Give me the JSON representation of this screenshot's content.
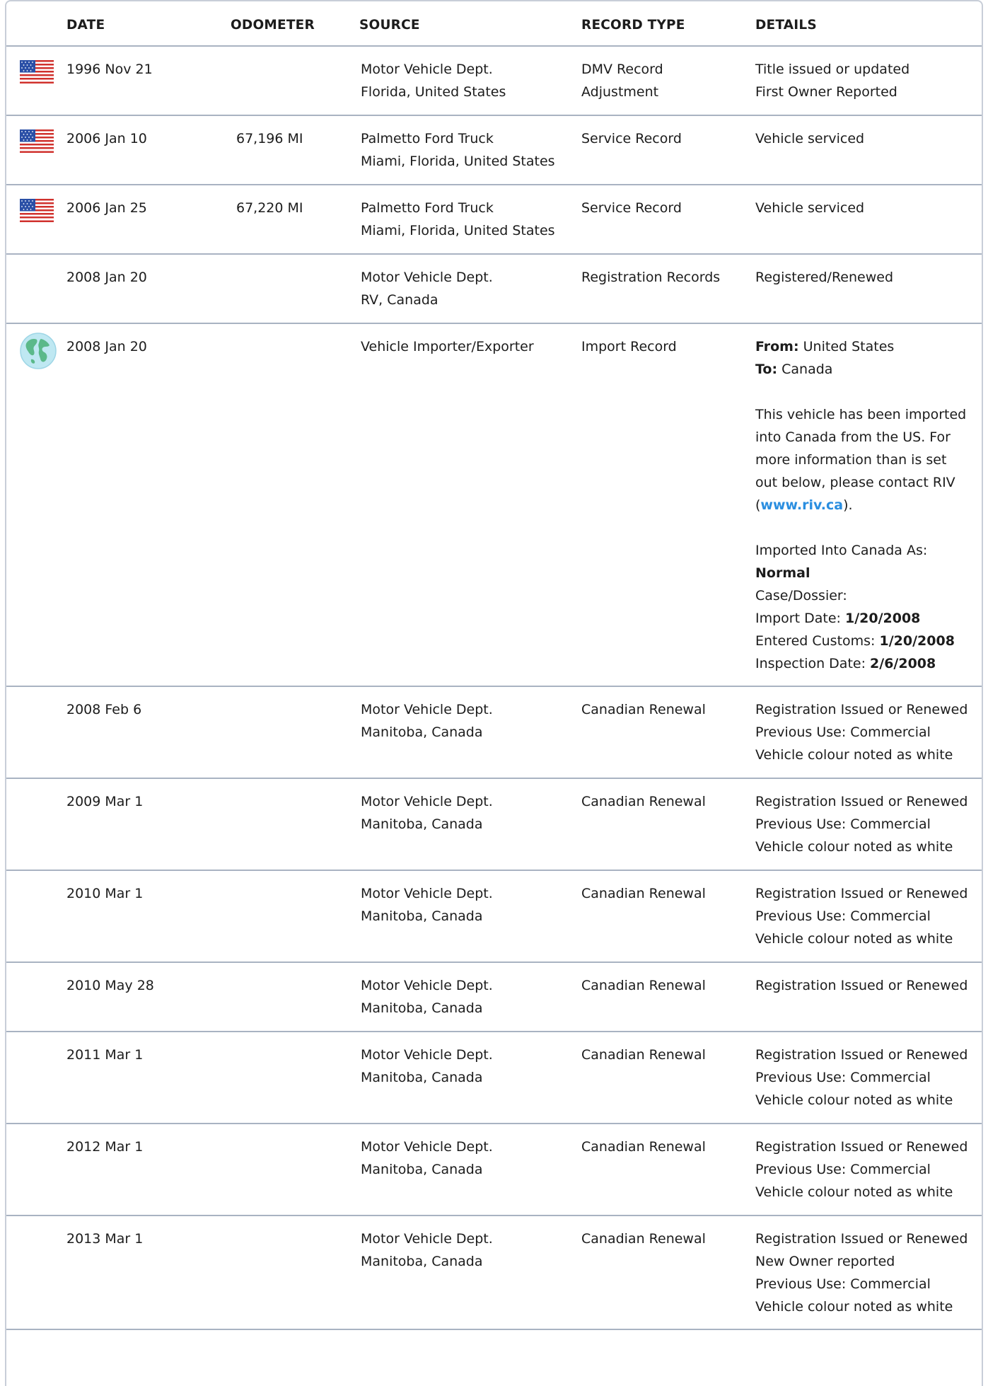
{
  "headers": {
    "date": "DATE",
    "odometer": "ODOMETER",
    "source": "SOURCE",
    "record_type": "RECORD TYPE",
    "details": "DETAILS"
  },
  "records": [
    {
      "icon": "us-flag-icon",
      "date": "1996 Nov 21",
      "odometer": "",
      "source": [
        "Motor Vehicle Dept.",
        "Florida, United States"
      ],
      "type": [
        "DMV Record",
        "Adjustment"
      ],
      "details": [
        "Title issued or updated",
        "First Owner Reported"
      ]
    },
    {
      "icon": "us-flag-icon",
      "date": "2006 Jan 10",
      "odometer": "67,196 MI",
      "source": [
        "Palmetto Ford Truck",
        "Miami, Florida, United States"
      ],
      "type": [
        "Service Record"
      ],
      "details": [
        "Vehicle serviced"
      ]
    },
    {
      "icon": "us-flag-icon",
      "date": "2006 Jan 25",
      "odometer": "67,220 MI",
      "source": [
        "Palmetto Ford Truck",
        "Miami, Florida, United States"
      ],
      "type": [
        "Service Record"
      ],
      "details": [
        "Vehicle serviced"
      ]
    },
    {
      "icon": "",
      "date": "2008 Jan 20",
      "odometer": "",
      "source": [
        "Motor Vehicle Dept.",
        "RV, Canada"
      ],
      "type": [
        "Registration Records"
      ],
      "details": [
        "Registered/Renewed"
      ]
    },
    {
      "icon": "globe-icon",
      "date": "2008 Jan 20",
      "odometer": "",
      "source": [
        "Vehicle Importer/Exporter"
      ],
      "type": [
        "Import Record"
      ],
      "import": {
        "from_label": "From:",
        "from_value": "United States",
        "to_label": "To:",
        "to_value": "Canada",
        "para_lines": [
          "This vehicle has been imported",
          "into Canada from the US. For",
          "more information than is set",
          "out below, please contact RIV"
        ],
        "link_open": "(",
        "link_text": "www.riv.ca",
        "link_close": ").",
        "imported_as_label": "Imported Into Canada As:",
        "imported_as_value": "Normal",
        "case_label": "Case/Dossier:",
        "import_date_label": "Import Date:",
        "import_date_value": "1/20/2008",
        "customs_label": "Entered Customs:",
        "customs_value": "1/20/2008",
        "inspection_label": "Inspection Date:",
        "inspection_value": "2/6/2008"
      }
    },
    {
      "icon": "",
      "date": "2008 Feb 6",
      "odometer": "",
      "source": [
        "Motor Vehicle Dept.",
        "Manitoba, Canada"
      ],
      "type": [
        "Canadian Renewal"
      ],
      "details": [
        "Registration Issued or Renewed",
        "Previous Use: Commercial",
        "Vehicle colour noted as white"
      ]
    },
    {
      "icon": "",
      "date": "2009 Mar 1",
      "odometer": "",
      "source": [
        "Motor Vehicle Dept.",
        "Manitoba, Canada"
      ],
      "type": [
        "Canadian Renewal"
      ],
      "details": [
        "Registration Issued or Renewed",
        "Previous Use: Commercial",
        "Vehicle colour noted as white"
      ]
    },
    {
      "icon": "",
      "date": "2010 Mar 1",
      "odometer": "",
      "source": [
        "Motor Vehicle Dept.",
        "Manitoba, Canada"
      ],
      "type": [
        "Canadian Renewal"
      ],
      "details": [
        "Registration Issued or Renewed",
        "Previous Use: Commercial",
        "Vehicle colour noted as white"
      ]
    },
    {
      "icon": "",
      "date": "2010 May 28",
      "odometer": "",
      "source": [
        "Motor Vehicle Dept.",
        "Manitoba, Canada"
      ],
      "type": [
        "Canadian Renewal"
      ],
      "details": [
        "Registration Issued or Renewed"
      ]
    },
    {
      "icon": "",
      "date": "2011 Mar 1",
      "odometer": "",
      "source": [
        "Motor Vehicle Dept.",
        "Manitoba, Canada"
      ],
      "type": [
        "Canadian Renewal"
      ],
      "details": [
        "Registration Issued or Renewed",
        "Previous Use: Commercial",
        "Vehicle colour noted as white"
      ]
    },
    {
      "icon": "",
      "date": "2012 Mar 1",
      "odometer": "",
      "source": [
        "Motor Vehicle Dept.",
        "Manitoba, Canada"
      ],
      "type": [
        "Canadian Renewal"
      ],
      "details": [
        "Registration Issued or Renewed",
        "Previous Use: Commercial",
        "Vehicle colour noted as white"
      ]
    },
    {
      "icon": "",
      "date": "2013 Mar 1",
      "odometer": "",
      "source": [
        "Motor Vehicle Dept.",
        "Manitoba, Canada"
      ],
      "type": [
        "Canadian Renewal"
      ],
      "details": [
        "Registration Issued or Renewed",
        "New Owner reported",
        "Previous Use: Commercial",
        "Vehicle colour noted as white"
      ]
    }
  ],
  "colors": {
    "border": "#a9b3c2",
    "link": "#2a8ee0",
    "text": "#1c1c1c"
  }
}
